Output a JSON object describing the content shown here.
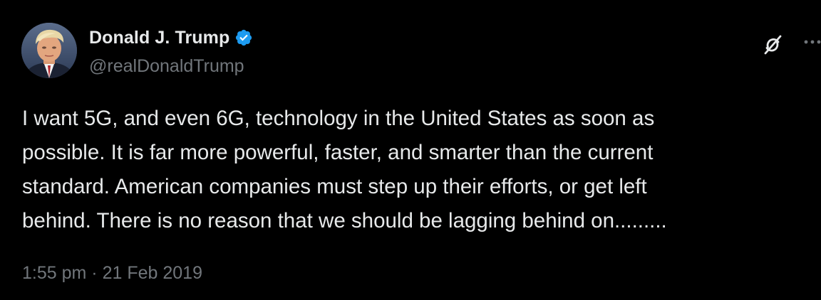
{
  "tweet": {
    "author": {
      "name": "Donald J. Trump",
      "handle": "@realDonaldTrump",
      "verified": true,
      "verified_color": "#1d9bf0",
      "avatar_icon": "profile-photo"
    },
    "text_lines": [
      "I want 5G, and even 6G, technology in the United States as soon as",
      "possible. It is far more powerful, faster, and smarter than the current",
      "standard. American companies must step up their efforts, or get left",
      "behind. There is no reason that we should be lagging behind on........."
    ],
    "time": "1:55 pm",
    "separator": "·",
    "date": "21 Feb 2019",
    "actions": {
      "grok_icon": "grok-icon",
      "more_icon": "more-options-icon"
    }
  },
  "colors": {
    "background": "#000000",
    "primary_text": "#e7e9ea",
    "secondary_text": "#71767b"
  }
}
